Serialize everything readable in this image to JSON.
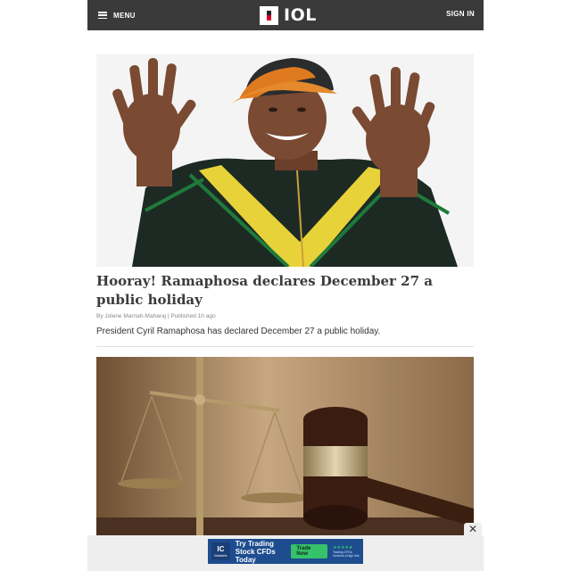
{
  "header": {
    "menu_label": "MENU",
    "brand": "IOL",
    "signin_label": "SIGN IN",
    "background_color": "#3a3a3a",
    "brand_accent_color": "#d6002a"
  },
  "articles": [
    {
      "title": "Hooray! Ramaphosa declares December 27 a public holiday",
      "byline": "By Jolene Marriah-Maharaj | Published 1h ago",
      "summary": "President Cyril Ramaphosa has declared December 27 a public holiday."
    }
  ],
  "ad": {
    "logo_mark": "IC",
    "logo_name": "Markets",
    "headline": "Try Trading Stock CFDs Today",
    "cta": "Trade Now",
    "rating": "★★★★★",
    "side_text": "Trading CFDs involves a high risk",
    "close_glyph": "✕"
  }
}
